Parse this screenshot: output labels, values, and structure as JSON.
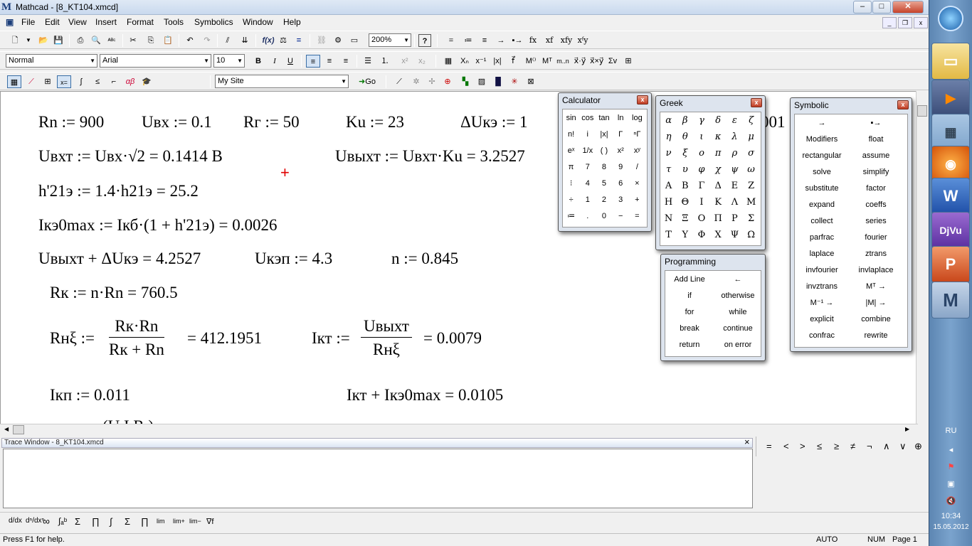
{
  "window": {
    "title": "Mathcad - [8_KT104.xmcd]",
    "min": "–",
    "max": "□",
    "close": "✕"
  },
  "menu": [
    "File",
    "Edit",
    "View",
    "Insert",
    "Format",
    "Tools",
    "Symbolics",
    "Window",
    "Help"
  ],
  "toolbar": {
    "zoom": "200%",
    "go_label": "Go",
    "style": "Normal",
    "font": "Arial",
    "size": "10",
    "site": "My Site"
  },
  "worksheet": {
    "r1": [
      "Rn := 900",
      "Uвх := 0.1",
      "Rг := 50",
      "Ku := 23",
      "ΔUкэ := 1",
      "001"
    ],
    "r2a": "Uвхт := Uвх·√2 = 0.1414 B",
    "r2b": "Uвыхт := Uвхт·Ku = 3.2527",
    "r3": "h'21э := 1.4·h21э = 25.2",
    "r4": "Iкэ0max := Iкб·(1 + h'21э) = 0.0026",
    "r5": [
      "Uвыхт + ΔUкэ = 4.2527",
      "Uкэп := 4.3",
      "n := 0.845"
    ],
    "r6": "Rк := n·Rn = 760.5",
    "r7": {
      "lhs": "Rнξ :=",
      "num": "Rк·Rn",
      "den": "Rк + Rn",
      "res": "= 412.1951",
      "lhs2": "Iкт :=",
      "num2": "Uвыхт",
      "den2": "Rнξ",
      "res2": "= 0.0079"
    },
    "r8": [
      "Iкп := 0.011",
      "Iкт + Iкэ0max = 0.0105"
    ],
    "r9": "(U         I     R )"
  },
  "calculator": {
    "title": "Calculator",
    "cells": [
      "sin",
      "cos",
      "tan",
      "ln",
      "log",
      "n!",
      "i",
      "|x|",
      "Γ",
      "ⁿΓ",
      "eˣ",
      "1/x",
      "( )",
      "x²",
      "xʸ",
      "π",
      "7",
      "8",
      "9",
      "/",
      "⁝",
      "4",
      "5",
      "6",
      "×",
      "÷",
      "1",
      "2",
      "3",
      "+",
      "≔",
      ".",
      "0",
      "−",
      "="
    ]
  },
  "greek": {
    "title": "Greek",
    "lower": [
      "α",
      "β",
      "γ",
      "δ",
      "ε",
      "ζ",
      "η",
      "θ",
      "ι",
      "κ",
      "λ",
      "μ",
      "ν",
      "ξ",
      "ο",
      "π",
      "ρ",
      "σ",
      "τ",
      "υ",
      "φ",
      "χ",
      "ψ",
      "ω"
    ],
    "upper": [
      "Α",
      "Β",
      "Γ",
      "Δ",
      "Ε",
      "Ζ",
      "Η",
      "Θ",
      "Ι",
      "Κ",
      "Λ",
      "Μ",
      "Ν",
      "Ξ",
      "Ο",
      "Π",
      "Ρ",
      "Σ",
      "Τ",
      "Υ",
      "Φ",
      "Χ",
      "Ψ",
      "Ω"
    ]
  },
  "programming": {
    "title": "Programming",
    "cells": [
      "Add Line",
      "←",
      "if",
      "otherwise",
      "for",
      "while",
      "break",
      "continue",
      "return",
      "on error"
    ]
  },
  "symbolic": {
    "title": "Symbolic",
    "cells": [
      "→",
      "▪→",
      "Modifiers",
      "float",
      "rectangular",
      "assume",
      "solve",
      "simplify",
      "substitute",
      "factor",
      "expand",
      "coeffs",
      "collect",
      "series",
      "parfrac",
      "fourier",
      "laplace",
      "ztrans",
      "invfourier",
      "invlaplace",
      "invztrans",
      "Mᵀ →",
      "M⁻¹ →",
      "|M| →",
      "explicit",
      "combine",
      "confrac",
      "rewrite"
    ]
  },
  "trace": {
    "title": "Trace Window - 8_KT104.xmcd",
    "close": "×"
  },
  "evaluation": [
    "=",
    "<",
    ">",
    "≤",
    "≥",
    "≠",
    "¬",
    "∧",
    "∨",
    "⊕"
  ],
  "calculus": [
    "d/dx",
    "dⁿ/dxⁿ",
    "∞",
    "∫ₐᵇ",
    "Σ",
    "∏",
    "∫",
    "Σ",
    "∏",
    "lim",
    "lim+",
    "lim−",
    "∇f"
  ],
  "status": {
    "help": "Press F1 for help.",
    "auto": "AUTO",
    "num": "NUM",
    "page": "Page 1"
  },
  "taskbar": {
    "lang": "RU",
    "time": "10:34",
    "date": "15.05.2012"
  },
  "colors": {
    "titlebar": "#c9d9ee",
    "taskbar": "#6a93bf",
    "close": "#c7432a",
    "cursor": "#e00000"
  }
}
